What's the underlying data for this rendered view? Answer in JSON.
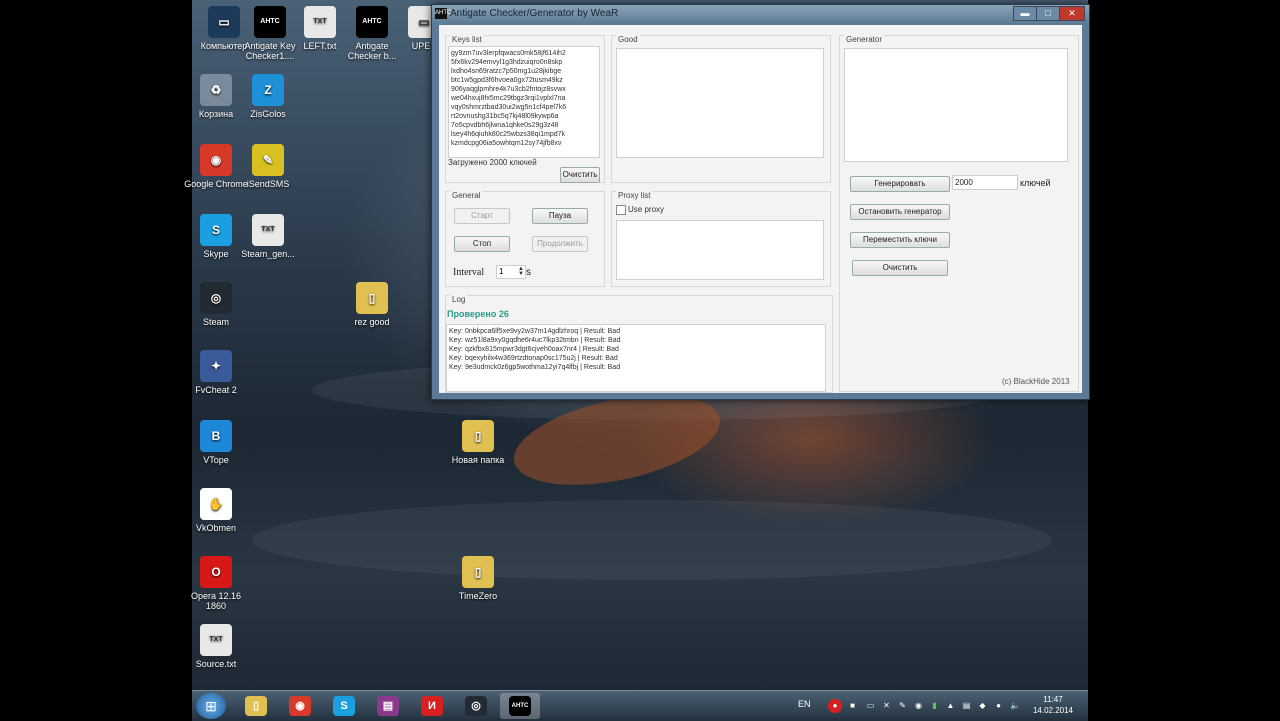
{
  "desktop": {
    "icons": [
      {
        "label": "Компьютер",
        "glyph": "▭",
        "color": "#1c3a5a"
      },
      {
        "label": "Antigate Key Checker1....",
        "glyph": "AHTC",
        "color": "#000000"
      },
      {
        "label": "LEFT.txt",
        "glyph": "TXT",
        "color": "#e8e8e8"
      },
      {
        "label": "Antigate Checker b...",
        "glyph": "AHTC",
        "color": "#000000"
      },
      {
        "label": "UPEP",
        "glyph": "▭",
        "color": "#e8e8e8"
      },
      {
        "label": "Корзина",
        "glyph": "♻",
        "color": "#7a8a9a"
      },
      {
        "label": "ZisGolos",
        "glyph": "Z",
        "color": "#1e90d8"
      },
      {
        "label": "Google Chrome",
        "glyph": "◉",
        "color": "#d83a2a"
      },
      {
        "label": "iSendSMS",
        "glyph": "✎",
        "color": "#d8c020"
      },
      {
        "label": "Skype",
        "glyph": "S",
        "color": "#1aa0e0"
      },
      {
        "label": "Steam_gen...",
        "glyph": "TXT",
        "color": "#e8e8e8"
      },
      {
        "label": "Steam",
        "glyph": "◎",
        "color": "#222a33"
      },
      {
        "label": "rez good",
        "glyph": "▯",
        "color": "#e0c050"
      },
      {
        "label": "FvCheat 2",
        "glyph": "✦",
        "color": "#3a5a9a"
      },
      {
        "label": "VTope",
        "glyph": "B",
        "color": "#1e88d8"
      },
      {
        "label": "Новая папка",
        "glyph": "▯",
        "color": "#e0c050"
      },
      {
        "label": "VkObmen",
        "glyph": "✋",
        "color": "#ffffff"
      },
      {
        "label": "Opera 12.16 1860",
        "glyph": "O",
        "color": "#d81818"
      },
      {
        "label": "TimeZero",
        "glyph": "▯",
        "color": "#e0c050"
      },
      {
        "label": "Source.txt",
        "glyph": "TXT",
        "color": "#e8e8e8"
      }
    ]
  },
  "window": {
    "title": "Antigate Checker/Generator by WeaR",
    "app_glyph": "AHTC",
    "minimize": "▬",
    "maximize": "□",
    "close": "✕",
    "keys": {
      "group_title": "Keys list",
      "lines": [
        "gy9zm7uv3lerpfqwacs0mk58jf614ih2",
        "5fx6kv294emvyl1g3hdzuiqro0n8skp",
        "lxdho4sn69ratzc7p50mg1u28jkibge",
        "btc1w5gpd3f6hvoea0gx72tusm49kz",
        "906yaqglpmhre4k7u3cb2fntojz8svwx",
        "we04hxuj8fx5mc29tbgz3rqi1vplxl7na",
        "vqy0shmrztbad30ui2wg5n1cf4pel7k6",
        "rt2ovnushg31bc5q7kj48l09kywp6a",
        "7o5cpvdbh6jlwna1qhke0s29g3z48",
        "lsey4h6qiuhk80c25wbzs38qi1mpd7k",
        "kzmdcpg06ia5owhtqm12sy74jfb8xv"
      ],
      "status": "Загружено 2000 ключей",
      "clear_label": "Очистить"
    },
    "good": {
      "group_title": "Good"
    },
    "generator": {
      "group_title": "Generator",
      "generate_label": "Генерировать",
      "count_value": "2000",
      "count_suffix": "ключей",
      "stop_label": "Остановить генератор",
      "move_label": "Переместить ключи",
      "clear_label": "Очистить",
      "copyright": "(c) BlackHide 2013"
    },
    "general": {
      "group_title": "General",
      "start_label": "Старт",
      "pause_label": "Пауза",
      "stop_label": "Стоп",
      "continue_label": "Продолжить",
      "interval_label": "Interval",
      "interval_value": "1",
      "interval_unit": "s"
    },
    "proxy": {
      "group_title": "Proxy list",
      "use_proxy_label": "Use proxy",
      "use_proxy_checked": false
    },
    "log": {
      "group_title": "Log",
      "checked_text": "Проверено 26",
      "lines": [
        "Key: 0nbkpca6lf5xe9vy2w37m14gdlzhroq | Result: Bad",
        "Key: wz51l8a9xy0gqdhe6r4uc7lkp32tmbn | Result: Bad",
        "Key: qzkfbx815mpwr3dgt6cjveh0oax7nr4 | Result: Bad",
        "Key: bqexyhilx4w369rtzdtonap0sc175u2j | Result: Bad",
        "Key: 9e3udmck0z6gp5wothma12yi7q4lfbj | Result: Bad"
      ]
    }
  },
  "taskbar": {
    "start_glyph": "⊞",
    "apps": [
      {
        "name": "explorer",
        "glyph": "▯",
        "color": "#e0c050"
      },
      {
        "name": "chrome",
        "glyph": "◉",
        "color": "#d83a2a"
      },
      {
        "name": "skype",
        "glyph": "S",
        "color": "#1aa0e0"
      },
      {
        "name": "winrar",
        "glyph": "▤",
        "color": "#8a3a8a"
      },
      {
        "name": "app",
        "glyph": "И",
        "color": "#d82020"
      },
      {
        "name": "steam",
        "glyph": "◎",
        "color": "#222a33"
      },
      {
        "name": "antigate",
        "glyph": "AHTC",
        "color": "#000000"
      }
    ],
    "language": "EN",
    "time": "11:47",
    "date": "14.02.2014"
  }
}
